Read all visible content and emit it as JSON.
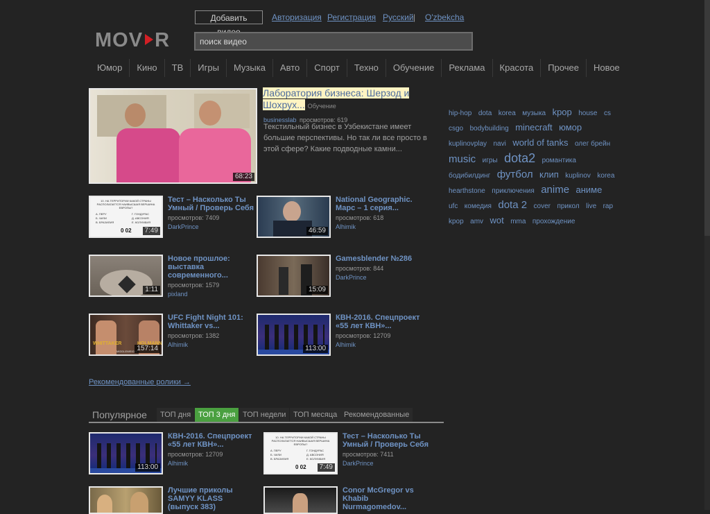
{
  "header": {
    "add_video": "Добавить видео",
    "links": [
      "Авторизация",
      "Регистрация",
      "Русский",
      "|",
      "O'zbekcha"
    ],
    "logo": "MOV",
    "logo_suffix": "R",
    "search_value": "поиск видео"
  },
  "nav": [
    "Юмор",
    "Кино",
    "ТВ",
    "Игры",
    "Музыка",
    "Авто",
    "Спорт",
    "Техно",
    "Обучение",
    "Реклама",
    "Красота",
    "Прочее",
    "Новое"
  ],
  "featured": {
    "title_line1": "Лаборатория бизнеса: Шерзод и",
    "title_line2": "Шохрух...",
    "category": "Обучение",
    "author": "businesslab",
    "views": "просмотров: 619",
    "description": "Текстильный бизнес в Узбекистане имеет большие перспективы. Но так ли все просто в этой сфере? Какие подводные камни...",
    "duration": "68:23"
  },
  "videos": [
    {
      "title_lines": [
        "Тест – Насколько Ты",
        "Умный / Проверь Себя"
      ],
      "views": "просмотров: 7409",
      "author": "DarkPrince",
      "duration": "7:49"
    },
    {
      "title_lines": [
        "National Geographic.",
        "Марс – 1 серия..."
      ],
      "views": "просмотров: 618",
      "author": "Alhimik",
      "duration": "46:59"
    },
    {
      "title_lines": [
        "Новое прошлое:",
        "выставка",
        "современного..."
      ],
      "views": "просмотров: 1579",
      "author": "pixland",
      "duration": "1:11"
    },
    {
      "title_lines": [
        "Gamesblender №286"
      ],
      "views": "просмотров: 844",
      "author": "DarkPrince",
      "duration": "15:09"
    },
    {
      "title_lines": [
        "UFC Fight Night 101:",
        "Whittaker vs..."
      ],
      "views": "просмотров: 1382",
      "author": "Alhimik",
      "duration": "157:14"
    },
    {
      "title_lines": [
        "КВН-2016. Спецпроект",
        "«55 лет КВН»..."
      ],
      "views": "просмотров: 12709",
      "author": "Alhimik",
      "duration": "113:00"
    }
  ],
  "recommended_link": "Рекомендованные ролики →",
  "tags": [
    {
      "t": "hip-hop",
      "s": 10
    },
    {
      "t": "dota",
      "s": 10
    },
    {
      "t": "korea",
      "s": 10
    },
    {
      "t": "музыка",
      "s": 10
    },
    {
      "t": "kpop",
      "s": 13
    },
    {
      "t": "house",
      "s": 10
    },
    {
      "t": "cs",
      "s": 10
    },
    {
      "t": "csgo",
      "s": 10
    },
    {
      "t": "bodybuilding",
      "s": 10
    },
    {
      "t": "minecraft",
      "s": 13
    },
    {
      "t": "юмор",
      "s": 13
    },
    {
      "t": "kuplinovplay",
      "s": 10
    },
    {
      "t": "navi",
      "s": 10
    },
    {
      "t": "world of tanks",
      "s": 13
    },
    {
      "t": "олег брейн",
      "s": 10
    },
    {
      "t": "music",
      "s": 15
    },
    {
      "t": "игры",
      "s": 10
    },
    {
      "t": "dota2",
      "s": 18
    },
    {
      "t": "романтика",
      "s": 10
    },
    {
      "t": "бодибилдинг",
      "s": 10
    },
    {
      "t": "футбол",
      "s": 15
    },
    {
      "t": "клип",
      "s": 13
    },
    {
      "t": "kuplinov",
      "s": 10
    },
    {
      "t": "korea",
      "s": 10
    },
    {
      "t": "hearthstone",
      "s": 10
    },
    {
      "t": "приключения",
      "s": 10
    },
    {
      "t": "anime",
      "s": 15
    },
    {
      "t": "аниме",
      "s": 13
    },
    {
      "t": "ufc",
      "s": 10
    },
    {
      "t": "комедия",
      "s": 10
    },
    {
      "t": "dota 2",
      "s": 15
    },
    {
      "t": "cover",
      "s": 10
    },
    {
      "t": "прикол",
      "s": 10
    },
    {
      "t": "live",
      "s": 10
    },
    {
      "t": "rap",
      "s": 10
    },
    {
      "t": "kpop",
      "s": 10
    },
    {
      "t": "amv",
      "s": 10
    },
    {
      "t": "wot",
      "s": 13
    },
    {
      "t": "mma",
      "s": 10
    },
    {
      "t": "прохождение",
      "s": 10
    }
  ],
  "tabs": {
    "title": "Популярное",
    "items": [
      "ТОП дня",
      "ТОП 3 дня",
      "ТОП недели",
      "ТОП месяца",
      "Рекомендованные"
    ],
    "active": "ТОП 3 дня"
  },
  "popular": [
    {
      "title_lines": [
        "КВН-2016. Спецпроект",
        "«55 лет КВН»..."
      ],
      "views": "просмотров: 12709",
      "author": "Alhimik",
      "duration": "113:00"
    },
    {
      "title_lines": [
        "Тест – Насколько Ты",
        "Умный / Проверь Себя"
      ],
      "views": "просмотров: 7411",
      "author": "DarkPrince",
      "duration": "7:49"
    },
    {
      "title_lines": [
        "Лучшие приколы",
        "SAMYY KLASS",
        "(выпуск 383)"
      ],
      "views": "",
      "author": "",
      "duration": ""
    },
    {
      "title_lines": [
        "Conor McGregor vs",
        "Khabib",
        "Nurmagomedov..."
      ],
      "views": "",
      "author": "",
      "duration": ""
    }
  ],
  "quiz_card": {
    "heading": "10. НА ТЕРРИТОРИИ КАКОЙ СТРАНЫ РАСПОЛАГАЕТСЯ НАИВЫСШАЯ ВЕРШИНА ЕВРОПЫ?",
    "opt_a": "А. ПЕРУ",
    "opt_b": "Б. ЧИЛИ",
    "opt_v": "В. БРАЗИЛИЯ",
    "opt_g": "Г. ГОНДУРАС",
    "opt_d": "Д. АВСОНИЯ",
    "opt_e": "Е. КОЛУМБИЯ",
    "timer": "0 02"
  },
  "ufc_labels": {
    "left": "WHITTAKER",
    "right": "HOLMANN",
    "bottom": "MIDDLEWEIGHT"
  },
  "colors": {
    "bg": "#232323",
    "link": "#6f93c4",
    "active_tab": "#4aa040",
    "highlight": "#fff4c2"
  }
}
